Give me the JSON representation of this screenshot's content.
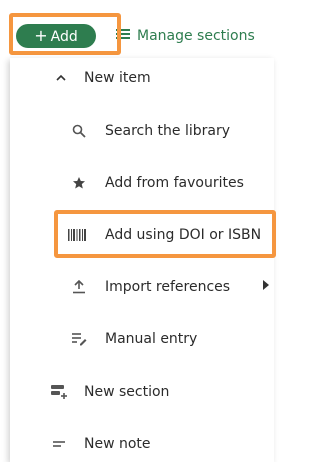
{
  "toolbar": {
    "add_label": "Add",
    "add_icon": "plus-icon",
    "manage_label": "Manage sections",
    "manage_icon": "sections-icon",
    "accent_color": "#2e7d4f",
    "highlight_color": "#f5963f"
  },
  "menu": {
    "group_label": "New item",
    "group_icon": "chevron-up-icon",
    "items": [
      {
        "label": "Search the library",
        "icon": "search-icon"
      },
      {
        "label": "Add from favourites",
        "icon": "star-icon"
      },
      {
        "label": "Add using DOI or ISBN",
        "icon": "barcode-icon"
      },
      {
        "label": "Import references",
        "icon": "upload-icon",
        "submenu_icon": "caret-right-icon"
      },
      {
        "label": "Manual entry",
        "icon": "edit-list-icon"
      }
    ],
    "new_section_label": "New section",
    "new_section_icon": "add-section-icon",
    "new_note_label": "New note",
    "new_note_icon": "note-icon"
  }
}
